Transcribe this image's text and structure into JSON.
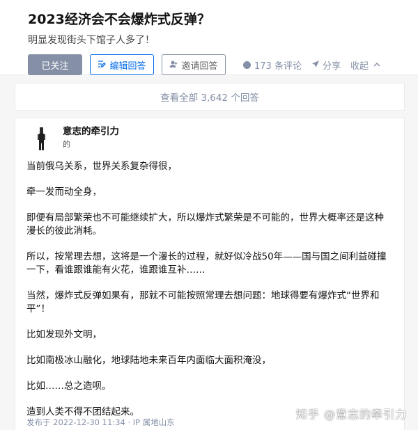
{
  "question": {
    "title": "2023经济会不会爆炸式反弹？",
    "detail": "明显发现街头下馆子人多了！"
  },
  "actions": {
    "followed_label": "已关注",
    "edit_label": "编辑回答",
    "invite_label": "邀请回答",
    "comments_label": "173 条评论",
    "share_label": "分享",
    "collapse_label": "收起"
  },
  "view_all_label": "查看全部 3,642 个回答",
  "answer": {
    "author_name": "意志的牵引力",
    "author_bio": "的",
    "paragraphs": [
      "当前俄乌关系，世界关系复杂得很，",
      "牵一发而动全身，",
      "即便有局部繁荣也不可能继续扩大，所以爆炸式繁荣是不可能的，世界大概率还是这种漫长的彼此消耗。",
      "所以，按常理去想，这将是一个漫长的过程，就好似冷战50年——国与国之间利益碰撞一下，看谁跟谁能有火花，谁跟谁互补……",
      "当然，爆炸式反弹如果有，那就不可能按照常理去想问题：地球得要有爆炸式“世界和平”！",
      "比如发现外文明，",
      "比如南极冰山融化，地球陆地未来百年内面临大面积淹没，",
      "比如……总之造呗。",
      "造到人类不得不团结起来。"
    ],
    "time": "发布于 2022-12-30 11:34 · IP 属地山东"
  },
  "watermark": "知乎 @意志的牵引力",
  "icons": {
    "edit": "edit-icon",
    "invite": "invite-icon",
    "comment": "comment-icon",
    "share": "share-icon",
    "collapse": "chevron-up-icon"
  },
  "colors": {
    "brand_blue": "#056de8",
    "muted": "#8590a6",
    "followed_bg": "#8590a6"
  }
}
